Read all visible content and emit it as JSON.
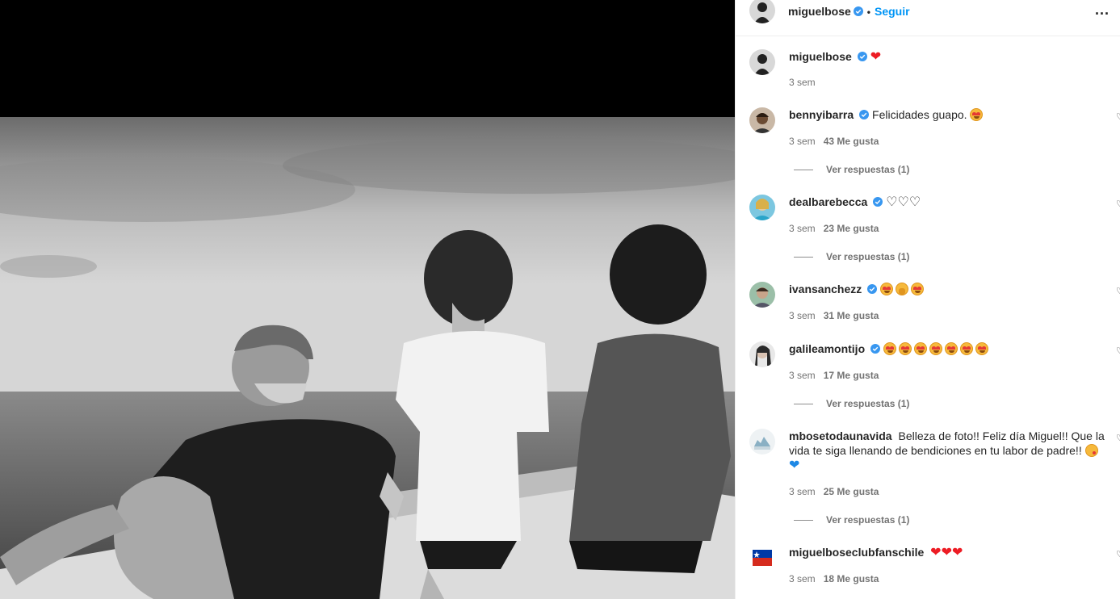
{
  "post": {
    "author": "miguelbose",
    "follow_label": "Seguir",
    "separator": "•",
    "more_label": "..."
  },
  "caption": {
    "username": "miguelbose",
    "emoji": "heart",
    "time": "3 sem"
  },
  "comments": [
    {
      "username": "bennyibarra",
      "text": "Felicidades guapo.",
      "emojis": "heart-eyes",
      "time": "3 sem",
      "likes": "43 Me gusta",
      "replies": "Ver respuestas (1)"
    },
    {
      "username": "dealbarebecca",
      "text": "",
      "emojis": "white-heart x3",
      "time": "3 sem",
      "likes": "23 Me gusta",
      "replies": "Ver respuestas (1)"
    },
    {
      "username": "ivansanchezz",
      "text": "",
      "emojis": "heart-eyes, raised-hands, heart-eyes",
      "time": "3 sem",
      "likes": "31 Me gusta",
      "replies": ""
    },
    {
      "username": "galileamontijo",
      "text": "",
      "emojis": "heart-eyes x7",
      "time": "3 sem",
      "likes": "17 Me gusta",
      "replies": "Ver respuestas (1)"
    },
    {
      "username": "mbosetodaunavida",
      "text": "Belleza de foto!! Feliz día Miguel!! Que la vida te siga llenando de bendiciones en tu labor de padre!!",
      "emojis": "kiss, blue-heart",
      "time": "3 sem",
      "likes": "25 Me gusta",
      "replies": "Ver respuestas (1)"
    },
    {
      "username": "miguelboseclubfanschile",
      "text": "",
      "emojis": "red-heart x3",
      "time": "3 sem",
      "likes": "18 Me gusta",
      "replies": ""
    }
  ],
  "colors": {
    "accent": "#0095f6",
    "verified": "#3897f0",
    "muted": "#737373"
  },
  "icons": {
    "verified": "verified-badge-icon",
    "like": "heart-icon",
    "more": "more-options-icon"
  }
}
